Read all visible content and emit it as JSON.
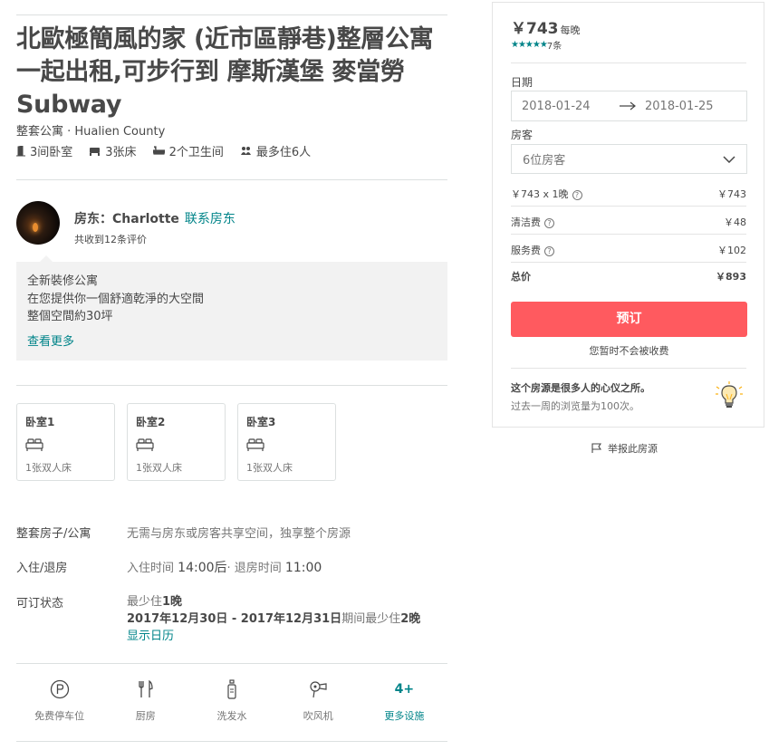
{
  "listing": {
    "title": "北歐極簡風的家 (近市區靜巷)整層公寓一起出租,可步行到 摩斯漢堡 麥當勞 Subway",
    "subtitle": "整套公寓 · Hualien County",
    "facts": {
      "bedrooms": "3间卧室",
      "beds": "3张床",
      "baths": "2个卫生间",
      "guests": "最多住6人"
    }
  },
  "host": {
    "label": "房东：Charlotte",
    "contact": "联系房东",
    "reviews": "共收到12条评价"
  },
  "description": {
    "lines": [
      "全新裝修公寓",
      "在您提供你一個舒適乾淨的大空間",
      "整個空間約30坪"
    ],
    "more": "查看更多"
  },
  "bedrooms": [
    {
      "name": "卧室1",
      "bed": "1张双人床"
    },
    {
      "name": "卧室2",
      "bed": "1张双人床"
    },
    {
      "name": "卧室3",
      "bed": "1张双人床"
    }
  ],
  "details": {
    "type_label": "整套房子/公寓",
    "type_value": "无需与房东或房客共享空间，独享整个房源",
    "checkin_label": "入住/退房",
    "checkin_prefix": "入住时间",
    "checkin_time": "14:00后",
    "checkout_prefix": "· 退房时间",
    "checkout_time": "11:00",
    "avail_label": "可订状态",
    "min_stay_prefix": "最少住",
    "min_stay_value": "1晚",
    "period": "2017年12月30日 - 2017年12月31日",
    "period_mid": "期间最少住",
    "period_nights": "2晚",
    "calendar_link": "显示日历"
  },
  "amenities": [
    {
      "icon": "parking-icon",
      "label": "免费停车位"
    },
    {
      "icon": "kitchen-icon",
      "label": "厨房"
    },
    {
      "icon": "shampoo-icon",
      "label": "洗发水"
    },
    {
      "icon": "hairdryer-icon",
      "label": "吹风机"
    }
  ],
  "amenities_more": {
    "count": "4+",
    "label": "更多设施"
  },
  "booking": {
    "price": "￥743",
    "per_night": "每晚",
    "rating_stars": 5,
    "review_count": "7条",
    "dates_label": "日期",
    "checkin": "2018-01-24",
    "checkout": "2018-01-25",
    "guests_label": "房客",
    "guests_value": "6位房客",
    "lines": [
      {
        "label": "￥743 x 1晚",
        "value": "￥743",
        "help": true
      },
      {
        "label": "清洁费",
        "value": "￥48",
        "help": true
      },
      {
        "label": "服务费",
        "value": "￥102",
        "help": true
      }
    ],
    "total_label": "总价",
    "total_value": "￥893",
    "book_button": "预订",
    "no_charge": "您暂时不会被收费",
    "popular_title": "这个房源是很多人的心仪之所。",
    "popular_sub": "过去一周的浏览量为100次。"
  },
  "report": "举报此房源",
  "colors": {
    "accent": "#008489",
    "book_button": "#ff5a5f",
    "text": "#484848",
    "muted": "#767676"
  }
}
